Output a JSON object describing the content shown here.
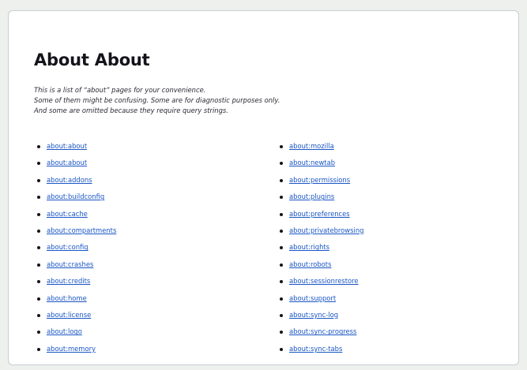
{
  "page": {
    "title": "About About",
    "intro_lines": [
      "This is a list of “about” pages for your convenience.",
      "Some of them might be confusing. Some are for diagnostic purposes only.",
      "And some are omitted because they require query strings."
    ]
  },
  "links": {
    "left": [
      "about:about",
      "about:about",
      "about:addons",
      "about:buildconfig",
      "about:cache",
      "about:compartments",
      "about:config",
      "about:crashes",
      "about:credits",
      "about:home",
      "about:license",
      "about:logo",
      "about:memory"
    ],
    "right": [
      "about:mozilla",
      "about:newtab",
      "about:permissions",
      "about:plugins",
      "about:preferences",
      "about:privatebrowsing",
      "about:rights",
      "about:robots",
      "about:sessionrestore",
      "about:support",
      "about:sync-log",
      "about:sync-progress",
      "about:sync-tabs"
    ]
  },
  "colors": {
    "link": "#1a56c4",
    "heading": "#15141a",
    "background": "#ffffff"
  }
}
